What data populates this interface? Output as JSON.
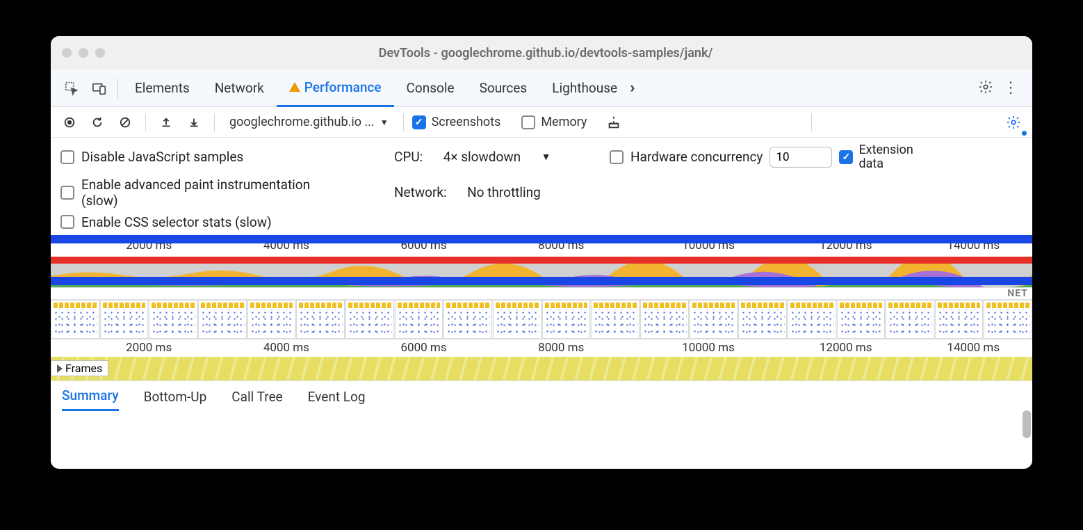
{
  "window": {
    "title": "DevTools - googlechrome.github.io/devtools-samples/jank/"
  },
  "tabs": [
    "Elements",
    "Network",
    "Performance",
    "Console",
    "Sources",
    "Lighthouse"
  ],
  "active_tab": "Performance",
  "toolbar": {
    "target_label": "googlechrome.github.io ...",
    "screenshots_label": "Screenshots",
    "memory_label": "Memory"
  },
  "options": {
    "disable_js_samples": "Disable JavaScript samples",
    "advanced_paint": "Enable advanced paint instrumentation (slow)",
    "css_selector_stats": "Enable CSS selector stats (slow)",
    "cpu_label": "CPU:",
    "cpu_value": "4× slowdown",
    "hw_concurrency_label": "Hardware concurrency",
    "hw_concurrency_value": "10",
    "extension_data_label": "Extension data",
    "network_label": "Network:",
    "network_value": "No throttling"
  },
  "timeline": {
    "ticks": [
      "2000 ms",
      "4000 ms",
      "6000 ms",
      "8000 ms",
      "10000 ms",
      "12000 ms",
      "14000 ms"
    ],
    "net_label": "NET",
    "frames_label": "Frames"
  },
  "bottom_tabs": [
    "Summary",
    "Bottom-Up",
    "Call Tree",
    "Event Log"
  ],
  "active_bottom_tab": "Summary"
}
